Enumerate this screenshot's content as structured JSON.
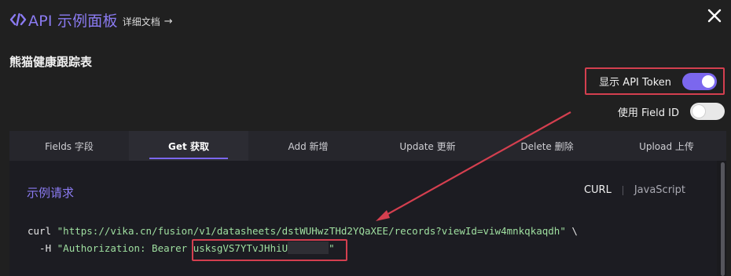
{
  "header": {
    "title": "API 示例面板",
    "docs_link": "详细文档",
    "logo_icon": "code-brackets-icon",
    "close_icon": "close-icon"
  },
  "sheet": {
    "name": "熊猫健康跟踪表"
  },
  "toggles": {
    "show_token": {
      "label": "显示 API Token",
      "on": true
    },
    "use_field_id": {
      "label": "使用 Field ID",
      "on": false
    }
  },
  "tabs": [
    {
      "label": "Fields 字段",
      "active": false
    },
    {
      "label": "Get 获取",
      "active": true
    },
    {
      "label": "Add 新增",
      "active": false
    },
    {
      "label": "Update 更新",
      "active": false
    },
    {
      "label": "Delete 删除",
      "active": false
    },
    {
      "label": "Upload 上传",
      "active": false
    }
  ],
  "example": {
    "title": "示例请求",
    "languages": [
      "CURL",
      "JavaScript"
    ],
    "selected_language": "CURL",
    "line1_cmd": "curl ",
    "line1_url": "\"https://vika.cn/fusion/v1/datasheets/dstWUHwzTHd2YQaXEE/records?viewId=viw4mnkqkaqdh\"",
    "line1_tail": " \\",
    "line2_flag": "  -H ",
    "line2_str": "\"Authorization: Bearer usksgVS7YTvJHhiU",
    "line2_end": "\""
  },
  "colors": {
    "accent": "#7b67ee",
    "highlight_border": "#d43f4f",
    "code_string": "#9fdfa0"
  }
}
